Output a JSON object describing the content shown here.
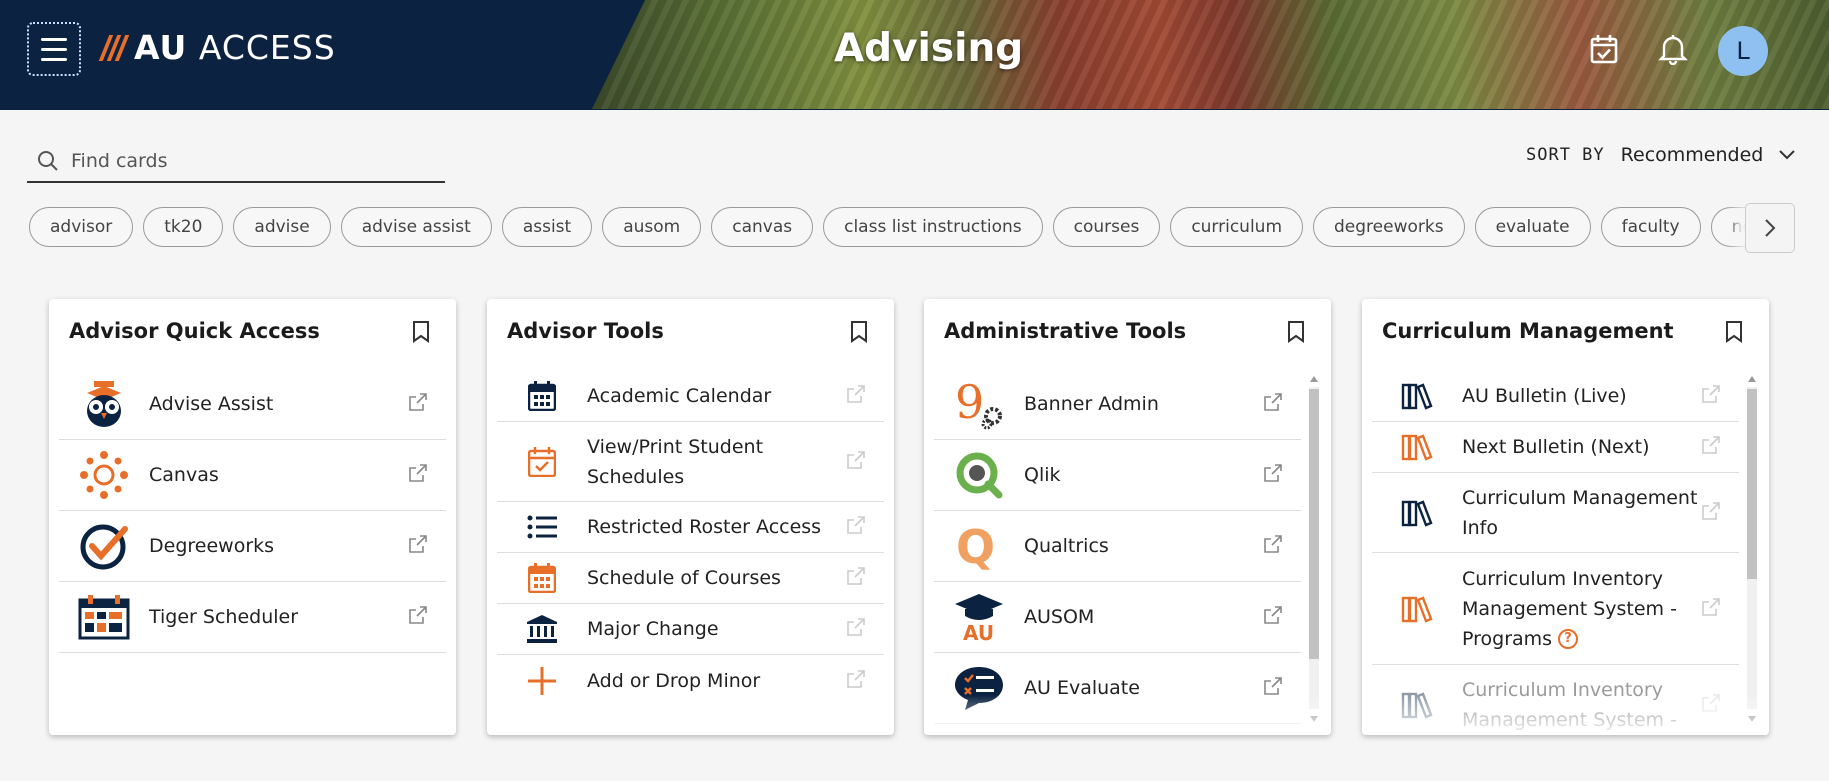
{
  "header": {
    "logo_prefix": "AU",
    "logo_suffix": "ACCESS",
    "page_title": "Advising",
    "avatar_initial": "L",
    "icons": [
      "menu-icon",
      "calendar-check-icon",
      "bell-icon"
    ]
  },
  "search": {
    "placeholder": "Find cards"
  },
  "sort": {
    "label": "SORT BY",
    "value": "Recommended"
  },
  "chips": [
    "advisor",
    "tk20",
    "advise",
    "advise assist",
    "assist",
    "ausom",
    "canvas",
    "class list instructions",
    "courses",
    "curriculum",
    "degreeworks",
    "evaluate",
    "faculty",
    "nextbulletin"
  ],
  "cards": {
    "quick_access": {
      "title": "Advisor Quick Access",
      "items": [
        {
          "label": "Advise Assist",
          "icon": "owl-icon"
        },
        {
          "label": "Canvas",
          "icon": "canvas-logo-icon"
        },
        {
          "label": "Degreeworks",
          "icon": "degreeworks-check-icon"
        },
        {
          "label": "Tiger Scheduler",
          "icon": "scheduler-calendar-icon"
        }
      ]
    },
    "advisor_tools": {
      "title": "Advisor Tools",
      "items": [
        {
          "label": "Academic Calendar",
          "icon": "calendar-icon"
        },
        {
          "label": "View/Print Student Schedules",
          "icon": "calendar-check-icon"
        },
        {
          "label": "Restricted Roster Access",
          "icon": "list-icon"
        },
        {
          "label": "Schedule of Courses",
          "icon": "calendar-grid-icon"
        },
        {
          "label": "Major Change",
          "icon": "institution-icon"
        },
        {
          "label": "Add or Drop Minor",
          "icon": "plus-icon"
        }
      ]
    },
    "admin_tools": {
      "title": "Administrative Tools",
      "items": [
        {
          "label": "Banner Admin",
          "icon": "banner-icon"
        },
        {
          "label": "Qlik",
          "icon": "qlik-icon"
        },
        {
          "label": "Qualtrics",
          "icon": "qualtrics-icon"
        },
        {
          "label": "AUSOM",
          "icon": "ausom-grad-cap-icon"
        },
        {
          "label": "AU Evaluate",
          "icon": "evaluate-chat-icon"
        }
      ]
    },
    "curriculum": {
      "title": "Curriculum Management",
      "items": [
        {
          "label": "AU Bulletin (Live)",
          "icon": "books-icon"
        },
        {
          "label": "Next Bulletin (Next)",
          "icon": "books-icon"
        },
        {
          "label": "Curriculum Management Info",
          "icon": "books-icon"
        },
        {
          "label": "Curriculum Inventory Management System - Programs",
          "icon": "books-icon"
        },
        {
          "label": "Curriculum Inventory Management System -",
          "icon": "books-icon"
        }
      ]
    }
  },
  "colors": {
    "navy": "#0b2341",
    "orange": "#e86f2a",
    "avatar": "#8fc0f2"
  }
}
